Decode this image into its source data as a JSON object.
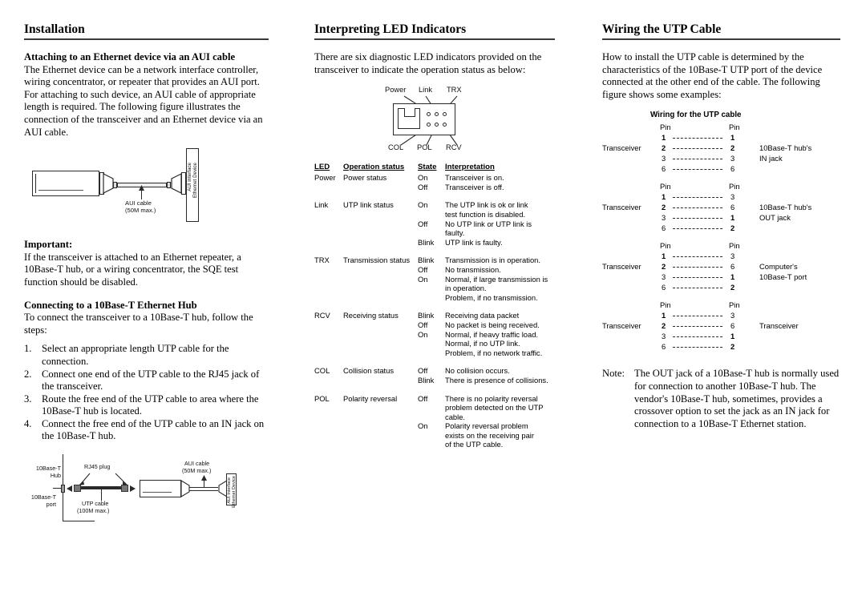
{
  "col1": {
    "heading": "Installation",
    "sub1": "Attaching to an Ethernet device via an AUI cable",
    "para1": "The Ethernet device can be a network interface controller, wiring concentrator, or repeater that provides an AUI port. For attaching to such device, an AUI cable of appropriate length is required. The following figure illustrates the connection of the transceiver and an Ethernet device via an AUI cable.",
    "fig1": {
      "cable_label_line1": "AUI cable",
      "cable_label_line2": "(50M max.)",
      "device_label_line1": "AUI interface",
      "device_label_line2": "Ethernet Device"
    },
    "sub2": "Important:",
    "para2": "If the transceiver is attached to an Ethernet repeater, a 10Base-T hub, or a wiring concentrator, the SQE test function should be disabled.",
    "sub3": "Connecting to a 10Base-T Ethernet Hub",
    "para3": "To connect the transceiver to a 10Base-T hub, follow the steps:",
    "steps": [
      {
        "num": "1.",
        "text": "Select an appropriate length UTP cable for the connection."
      },
      {
        "num": "2.",
        "text": "Connect one end of the UTP cable to the RJ45 jack of the transceiver."
      },
      {
        "num": "3.",
        "text": "Route the free end of the UTP cable to area where the 10Base-T hub is located."
      },
      {
        "num": "4.",
        "text": "Connect the free end of the UTP cable to an IN jack on the 10Base-T hub."
      }
    ],
    "fig2": {
      "hub_line1": "10Base-T",
      "hub_line2": "Hub",
      "port_line1": "10Base-T",
      "port_line2": "port",
      "rj45_label": "RJ45 plug",
      "utp_line1": "UTP cable",
      "utp_line2": "(100M max.)",
      "aui_line1": "AUI cable",
      "aui_line2": "(50M max.)",
      "device_label_line1": "AUI Interface",
      "device_label_line2": "Ethernet Device"
    }
  },
  "col2": {
    "heading": "Interpreting LED Indicators",
    "para1": "There are six diagnostic LED indicators provided on the transceiver to indicate the operation status as below:",
    "ledfig": {
      "top_labels": [
        "Power",
        "Link",
        "TRX"
      ],
      "bottom_labels": [
        "COL",
        "POL",
        "RCV"
      ]
    },
    "table": {
      "headers": [
        "LED",
        "Operation status",
        "State",
        "Interpretation"
      ],
      "rows": [
        {
          "led": "Power",
          "operation": "Power status",
          "states": [
            {
              "state": "On",
              "lines": [
                "Transceiver is on."
              ]
            },
            {
              "state": "Off",
              "lines": [
                "Transceiver is off."
              ]
            }
          ]
        },
        {
          "led": "Link",
          "operation": "UTP link status",
          "states": [
            {
              "state": "On",
              "lines": [
                "The UTP link is ok or link",
                "test function is disabled."
              ]
            },
            {
              "state": "Off",
              "lines": [
                "No UTP link or UTP link is",
                "faulty."
              ]
            },
            {
              "state": "Blink",
              "lines": [
                "UTP link is faulty."
              ]
            }
          ]
        },
        {
          "led": "TRX",
          "operation": "Transmission status",
          "states": [
            {
              "state": "Blink",
              "lines": [
                "Transmission is in operation."
              ]
            },
            {
              "state": "Off",
              "lines": [
                "No transmission."
              ]
            },
            {
              "state": "On",
              "lines": [
                "Normal, if large transmission is",
                "in operation.",
                "Problem, if no transmission."
              ]
            }
          ]
        },
        {
          "led": "RCV",
          "operation": "Receiving status",
          "states": [
            {
              "state": "Blink",
              "lines": [
                "Receiving data packet"
              ]
            },
            {
              "state": "Off",
              "lines": [
                "No packet is being received."
              ]
            },
            {
              "state": "On",
              "lines": [
                "Normal, if heavy traffic load.",
                "Normal, if no UTP link.",
                "Problem, if no network traffic."
              ]
            }
          ]
        },
        {
          "led": "COL",
          "operation": "Collision status",
          "states": [
            {
              "state": "Off",
              "lines": [
                "No collision occurs."
              ]
            },
            {
              "state": "Blink",
              "lines": [
                "There is presence of collisions."
              ]
            }
          ]
        },
        {
          "led": "POL",
          "operation": "Polarity reversal",
          "states": [
            {
              "state": "Off",
              "lines": [
                "There is no polarity reversal",
                "problem detected on the UTP",
                "cable."
              ]
            },
            {
              "state": "On",
              "lines": [
                "Polarity reversal problem",
                "exists on the receiving pair",
                "of the UTP cable."
              ]
            }
          ]
        }
      ]
    }
  },
  "col3": {
    "heading": "Wiring the UTP Cable",
    "para1": "How to install the UTP cable is determined by the characteristics of the 10Base-T UTP port of the device connected at the other end of the cable. The following figure shows some examples:",
    "wiring": {
      "title": "Wiring for the UTP cable",
      "pin_header_left": "Pin",
      "pin_header_right": "Pin",
      "blocks": [
        {
          "left_label": "Transceiver",
          "right_label_lines": [
            "10Base-T hub's",
            "IN jack"
          ],
          "pairs": [
            {
              "left": "1",
              "left_bold": true,
              "right": "1",
              "right_bold": true
            },
            {
              "left": "2",
              "left_bold": true,
              "right": "2",
              "right_bold": true
            },
            {
              "left": "3",
              "left_bold": false,
              "right": "3",
              "right_bold": false
            },
            {
              "left": "6",
              "left_bold": false,
              "right": "6",
              "right_bold": false
            }
          ]
        },
        {
          "left_label": "Transceiver",
          "right_label_lines": [
            "10Base-T hub's",
            "OUT jack"
          ],
          "pairs": [
            {
              "left": "1",
              "left_bold": true,
              "right": "3",
              "right_bold": false
            },
            {
              "left": "2",
              "left_bold": true,
              "right": "6",
              "right_bold": false
            },
            {
              "left": "3",
              "left_bold": false,
              "right": "1",
              "right_bold": true
            },
            {
              "left": "6",
              "left_bold": false,
              "right": "2",
              "right_bold": true
            }
          ]
        },
        {
          "left_label": "Transceiver",
          "right_label_lines": [
            "Computer's",
            "10Base-T port"
          ],
          "pairs": [
            {
              "left": "1",
              "left_bold": true,
              "right": "3",
              "right_bold": false
            },
            {
              "left": "2",
              "left_bold": true,
              "right": "6",
              "right_bold": false
            },
            {
              "left": "3",
              "left_bold": false,
              "right": "1",
              "right_bold": true
            },
            {
              "left": "6",
              "left_bold": false,
              "right": "2",
              "right_bold": true
            }
          ]
        },
        {
          "left_label": "Transceiver",
          "right_label_lines": [
            "Transceiver"
          ],
          "pairs": [
            {
              "left": "1",
              "left_bold": true,
              "right": "3",
              "right_bold": false
            },
            {
              "left": "2",
              "left_bold": true,
              "right": "6",
              "right_bold": false
            },
            {
              "left": "3",
              "left_bold": false,
              "right": "1",
              "right_bold": true
            },
            {
              "left": "6",
              "left_bold": false,
              "right": "2",
              "right_bold": true
            }
          ]
        }
      ]
    },
    "note_label": "Note:",
    "note_text": "The OUT jack of a 10Base-T hub is normally used for connection to another 10Base-T hub. The vendor's 10Base-T hub, sometimes, provides a crossover option to set the jack as an IN jack for connection to a 10Base-T Ethernet station."
  }
}
